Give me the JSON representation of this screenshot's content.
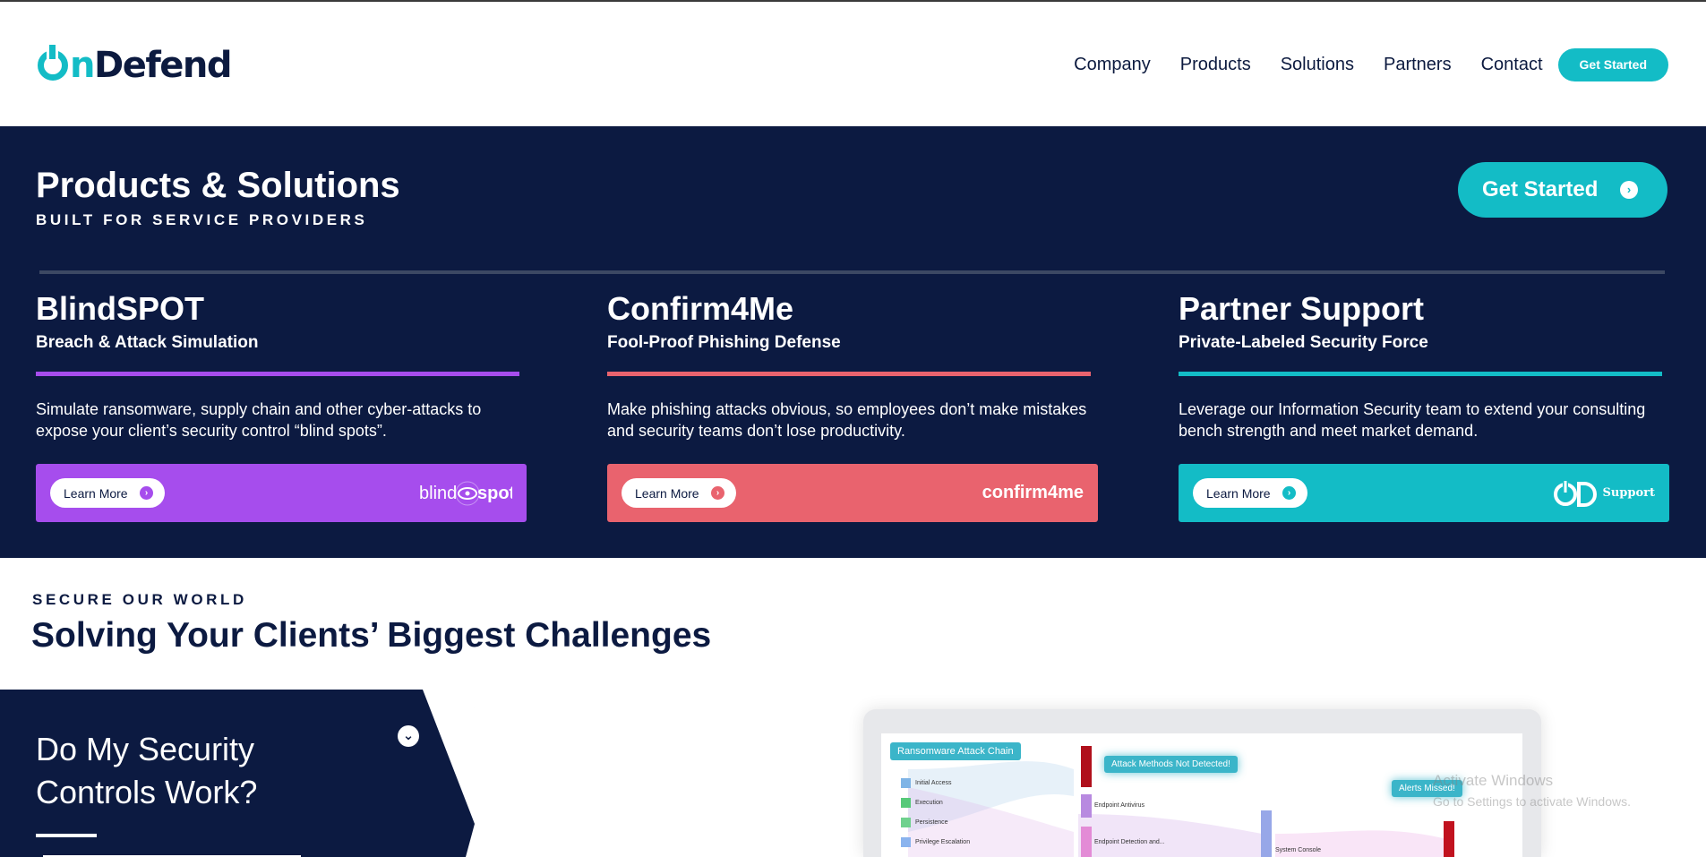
{
  "header": {
    "logo_text_start": "O",
    "logo_n": "n",
    "logo_text_rest": "Defend",
    "nav": [
      "Company",
      "Products",
      "Solutions",
      "Partners",
      "Contact"
    ],
    "cta": "Get Started"
  },
  "hero": {
    "title": "Products & Solutions",
    "subtitle": "BUILT FOR SERVICE PROVIDERS",
    "cta": "Get Started"
  },
  "products": [
    {
      "title": "BlindSPOT",
      "subtitle": "Breach & Attack Simulation",
      "description": "Simulate ransomware, supply chain and other cyber-attacks to expose your client’s security control “blind spots”.",
      "button": "Learn More",
      "logo": "blindspot",
      "color": "#a64ded"
    },
    {
      "title": "Confirm4Me",
      "subtitle": "Fool-Proof Phishing Defense",
      "description": "Make phishing attacks obvious, so employees don’t make mistakes and security teams don’t lose productivity.",
      "button": "Learn More",
      "logo": "confirm4me",
      "color": "#e9636e"
    },
    {
      "title": "Partner Support",
      "subtitle": "Private-Labeled Security Force",
      "description": "Leverage our Information Security team to extend your consulting bench strength and meet market demand.",
      "button": "Learn More",
      "logo": "Support",
      "color": "#13bcc6"
    }
  ],
  "section": {
    "eyebrow": "SECURE OUR WORLD",
    "title": "Solving Your Clients’ Biggest Challenges"
  },
  "question": {
    "line1": "Do My Security",
    "line2": "Controls Work?"
  },
  "screen": {
    "chain_label": "Ransomware Attack Chain",
    "alert1": "Attack Methods Not Detected!",
    "alert2": "Alerts Missed!",
    "legend": [
      "Initial Access",
      "Execution",
      "Persistence",
      "Privilege Escalation"
    ],
    "mid_labels": [
      "Endpoint Antivirus",
      "Endpoint Detection and..."
    ],
    "right_label": "System Console"
  },
  "watermark": {
    "line1": "Activate Windows",
    "line2": "Go to Settings to activate Windows."
  }
}
